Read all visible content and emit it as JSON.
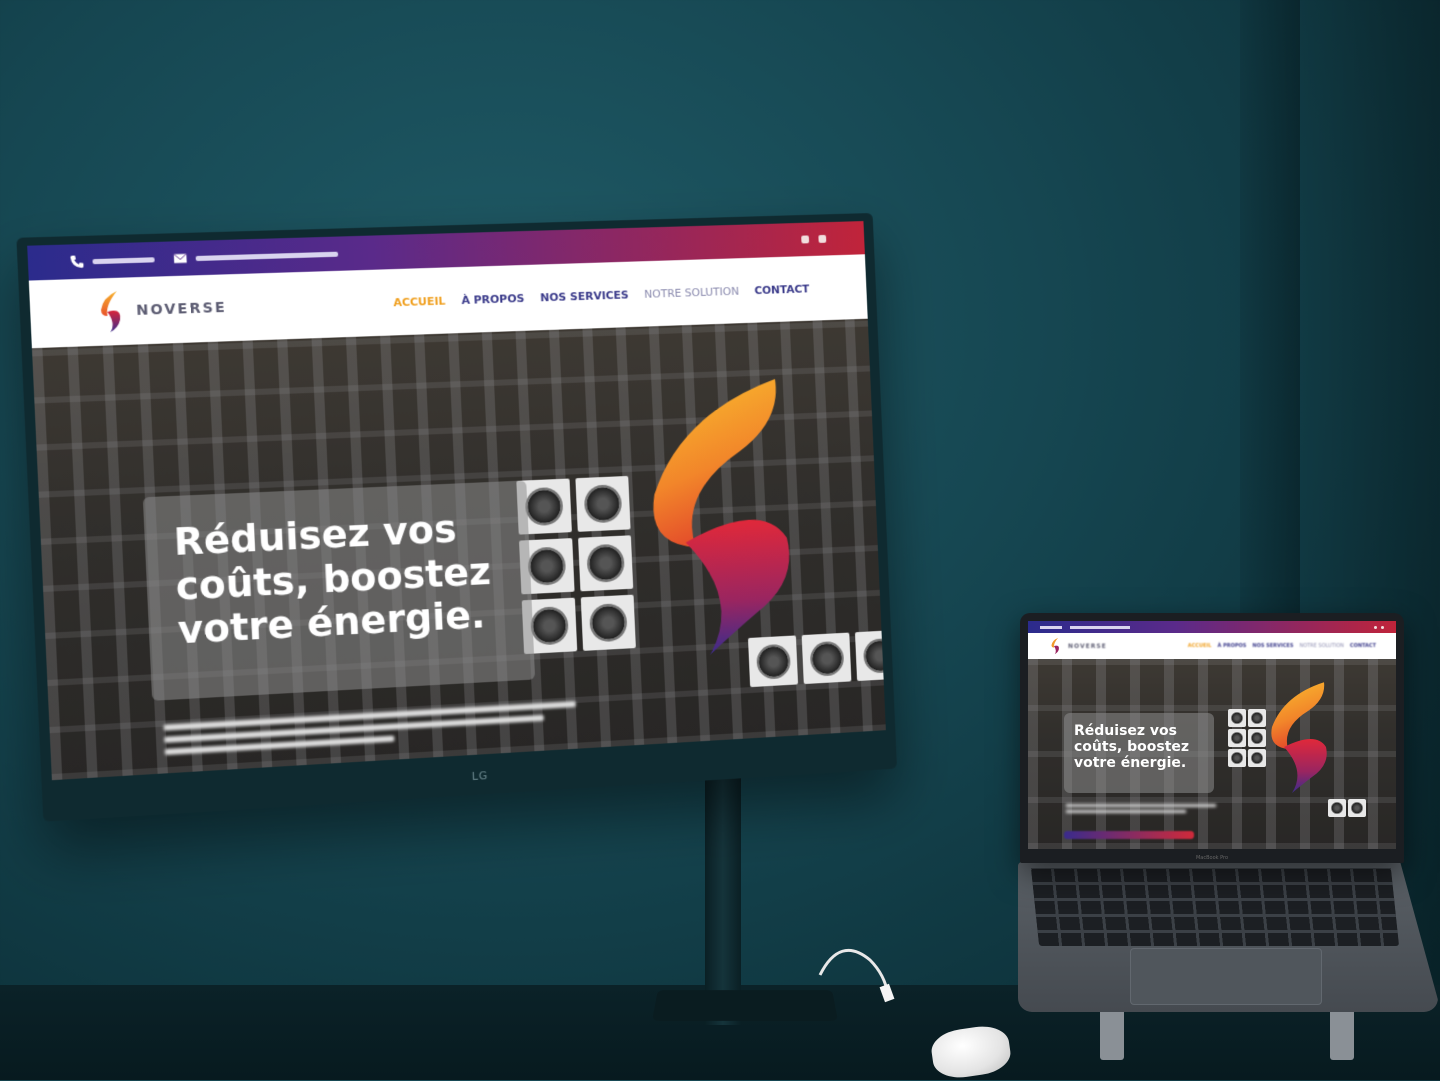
{
  "scene": {
    "monitor_brand": "LG",
    "laptop_brand": "MacBook Pro"
  },
  "site": {
    "brand_name": "NOVERSE",
    "nav": [
      {
        "label": "ACCUEIL",
        "active": true
      },
      {
        "label": "À PROPOS",
        "active": false
      },
      {
        "label": "NOS SERVICES",
        "active": false
      },
      {
        "label": "NOTRE SOLUTION",
        "active": false
      },
      {
        "label": "CONTACT",
        "active": false
      }
    ],
    "hero_title": [
      "Réduisez vos",
      "coûts, boostez",
      "votre énergie."
    ]
  },
  "colors": {
    "topbar_start": "#2b2b8c",
    "topbar_end": "#c0243a",
    "nav_active": "#f0a020",
    "nav_default": "#3a3a8a",
    "wall": "#164752"
  },
  "icons": {
    "phone": "phone-icon",
    "email": "email-icon",
    "logo": "flame-logo-icon"
  }
}
